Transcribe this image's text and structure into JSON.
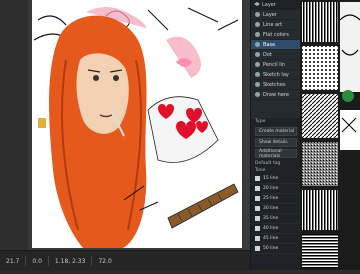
{
  "canvas": {
    "artwork": "manga-girl-with-red-hair-and-hearts"
  },
  "bottombar": {
    "zoom": "21.7",
    "angle": "0.0",
    "coords": "1.18, 2.33",
    "size": "72.0"
  },
  "layer_panel": {
    "title": "Layer",
    "layers": [
      {
        "label": "Layer",
        "selected": false
      },
      {
        "label": "Line art",
        "selected": false
      },
      {
        "label": "Flat colors",
        "selected": false
      },
      {
        "label": "Base",
        "selected": true
      },
      {
        "label": "Dot",
        "selected": false
      },
      {
        "label": "Pencil lin",
        "selected": false
      },
      {
        "label": "Sketch lay",
        "selected": false
      },
      {
        "label": "Sketches",
        "selected": false
      },
      {
        "label": "Draw here",
        "selected": false
      }
    ]
  },
  "properties": {
    "type_label": "Type",
    "buttons": [
      "Create material",
      "Show details",
      "Additional materials"
    ],
    "default_tag": "Default tag",
    "tone_label": "Tone",
    "tones": [
      "15 line",
      "20 line",
      "25 line",
      "30 line",
      "35 line",
      "40 line",
      "45 line",
      "50 line"
    ]
  },
  "colors": {
    "panel_bg": "#262b30",
    "selected_layer": "#2f4d6a",
    "hair": "#e55a1c",
    "heart": "#e0102a"
  }
}
